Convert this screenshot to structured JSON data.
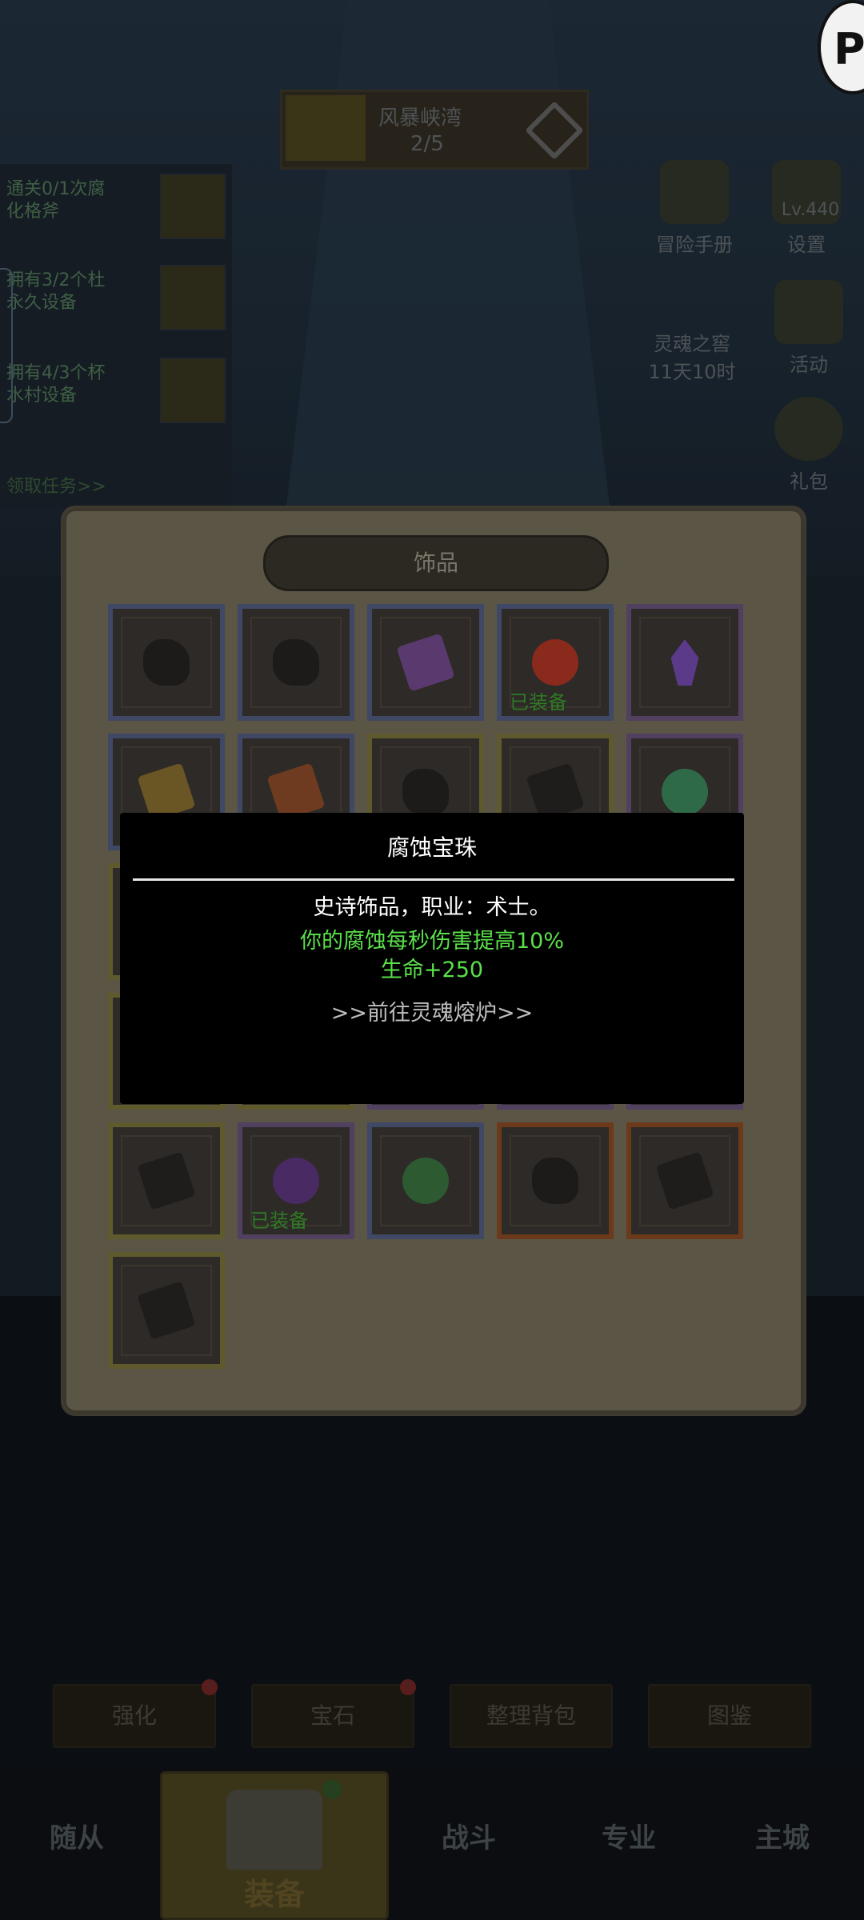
{
  "stage": {
    "name": "风暴峡湾",
    "progress": "2/5"
  },
  "quests": [
    {
      "line1": "通关0/1次腐",
      "line2": "化格斧"
    },
    {
      "line1": "拥有3/2个杜",
      "line2": "永久设备"
    },
    {
      "line1": "拥有4/3个杯",
      "line2": "水村设备"
    }
  ],
  "quest_link": "领取任务>>",
  "top_right": {
    "handbook": "冒险手册",
    "level": "Lv.440",
    "settings": "设置",
    "soul_cellar": "灵魂之窖",
    "countdown": "11天10时",
    "events": "活动",
    "gift": "礼包"
  },
  "avatar_letter": "P",
  "modal": {
    "tab_title": "饰品",
    "equipped_label": "已装备",
    "items": [
      {
        "row": 0,
        "col": 0,
        "rarity": "blue",
        "icon": "dark-rock-icon",
        "equipped": false
      },
      {
        "row": 0,
        "col": 1,
        "rarity": "blue",
        "icon": "dark-rock-icon",
        "equipped": false
      },
      {
        "row": 0,
        "col": 2,
        "rarity": "blue",
        "icon": "purple-book-icon",
        "equipped": false
      },
      {
        "row": 0,
        "col": 3,
        "rarity": "blue",
        "icon": "fire-crown-orb-icon",
        "equipped": true
      },
      {
        "row": 0,
        "col": 4,
        "rarity": "purple",
        "icon": "purple-crystal-icon",
        "equipped": false
      },
      {
        "row": 1,
        "col": 0,
        "rarity": "blue",
        "icon": "treasure-chest-icon",
        "equipped": false
      },
      {
        "row": 1,
        "col": 1,
        "rarity": "blue",
        "icon": "orange-chest-icon",
        "equipped": false
      },
      {
        "row": 1,
        "col": 2,
        "rarity": "yellow",
        "icon": "dark-rock-icon",
        "equipped": false
      },
      {
        "row": 1,
        "col": 3,
        "rarity": "yellow",
        "icon": "dark-book-icon",
        "equipped": false
      },
      {
        "row": 1,
        "col": 4,
        "rarity": "purple",
        "icon": "green-orb-icon",
        "equipped": false
      },
      {
        "row": 2,
        "col": 0,
        "rarity": "yellow",
        "icon": "empty-icon",
        "equipped": false
      },
      {
        "row": 2,
        "col": 4,
        "rarity": "yellow",
        "icon": "empty-icon",
        "equipped": false
      },
      {
        "row": 3,
        "col": 0,
        "rarity": "yellow",
        "icon": "empty-icon",
        "equipped": false
      },
      {
        "row": 3,
        "col": 1,
        "rarity": "yellow",
        "icon": "empty-icon",
        "equipped": false
      },
      {
        "row": 3,
        "col": 2,
        "rarity": "purple",
        "icon": "empty-icon",
        "equipped": false
      },
      {
        "row": 3,
        "col": 3,
        "rarity": "purple",
        "icon": "empty-icon",
        "equipped": false
      },
      {
        "row": 3,
        "col": 4,
        "rarity": "purple",
        "icon": "empty-icon",
        "equipped": false
      },
      {
        "row": 4,
        "col": 0,
        "rarity": "yellow",
        "icon": "dark-book-icon",
        "equipped": false
      },
      {
        "row": 4,
        "col": 1,
        "rarity": "purple",
        "icon": "skull-orb-icon",
        "equipped": true
      },
      {
        "row": 4,
        "col": 2,
        "rarity": "blue",
        "icon": "green-leaf-orb-icon",
        "equipped": false
      },
      {
        "row": 4,
        "col": 3,
        "rarity": "orange",
        "icon": "dark-rock-icon",
        "equipped": false
      },
      {
        "row": 4,
        "col": 4,
        "rarity": "orange",
        "icon": "dark-book-icon",
        "equipped": false
      },
      {
        "row": 5,
        "col": 0,
        "rarity": "yellow",
        "icon": "dark-book-icon",
        "equipped": false
      }
    ]
  },
  "tooltip": {
    "title": "腐蚀宝珠",
    "description": "史诗饰品，职业：术士。",
    "effect1": "你的腐蚀每秒伤害提高10%",
    "effect2": "生命+250",
    "link": ">>前往灵魂熔炉>>"
  },
  "bottom_actions": [
    {
      "label": "强化",
      "badge": "!"
    },
    {
      "label": "宝石",
      "badge": "!"
    },
    {
      "label": "整理背包",
      "badge": ""
    },
    {
      "label": "图鉴",
      "badge": ""
    }
  ],
  "nav": {
    "followers": "随从",
    "equipment": "装备",
    "battle": "战斗",
    "profession": "专业",
    "city": "主城"
  },
  "colors": {
    "effect_green": "#5ae04a",
    "equipped_green": "#2f7a25",
    "rarity_blue": "#3f4864",
    "rarity_purple": "#514060",
    "rarity_yellow": "#5f5a2e",
    "rarity_orange": "#6b3a1a"
  }
}
